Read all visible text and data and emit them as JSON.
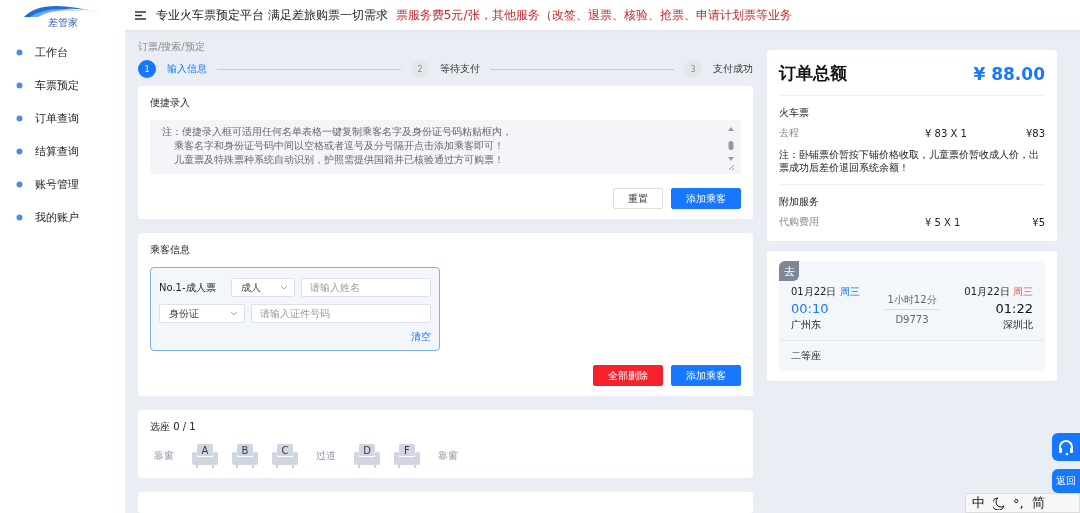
{
  "logo": {
    "text": "差管家"
  },
  "header": {
    "slogan": "专业火车票预定平台 满足差旅购票一切需求",
    "notice": "票服务费5元/张，其他服务（改签、退票、核验、抢票、申请计划票等业务"
  },
  "sidebar": {
    "items": [
      {
        "label": "工作台",
        "selected": false
      },
      {
        "label": "车票预定",
        "selected": false
      },
      {
        "label": "订单查询",
        "selected": false
      },
      {
        "label": "结算查询",
        "selected": false
      },
      {
        "label": "账号管理",
        "selected": false
      },
      {
        "label": "我的账户",
        "selected": false
      }
    ]
  },
  "breadcrumb": "订票/搜索/预定",
  "steps": [
    {
      "number": "1",
      "label": "输入信息",
      "selected": true
    },
    {
      "number": "2",
      "label": "等待支付",
      "selected": false
    },
    {
      "number": "3",
      "label": "支付成功",
      "selected": false
    }
  ],
  "quick_entry": {
    "title": "便捷录入",
    "placeholder": [
      "注：便捷录入框可适用任何名单表格一键复制乘客名字及身份证号码粘贴框内，",
      "乘客名字和身份证号码中间以空格或者逗号及分号隔开点击添加乘客即可！",
      "儿童票及特殊票种系统自动识别，护照需提供国籍并已核验通过方可购票！"
    ],
    "buttons": [
      {
        "label": "重置",
        "kind": "default"
      },
      {
        "label": "添加乘客",
        "kind": "primary"
      }
    ]
  },
  "passengers": {
    "title": "乘客信息",
    "items": [
      {
        "label": "No.1-成人票",
        "ticket_type": "成人",
        "name_placeholder": "请输入姓名",
        "id_type": "身份证",
        "id_placeholder": "请输入证件号码",
        "clear": "清空"
      }
    ],
    "buttons": [
      {
        "label": "全部删除",
        "kind": "danger"
      },
      {
        "label": "添加乘客",
        "kind": "primary"
      }
    ]
  },
  "seats": {
    "title": "选座 0 / 1",
    "items": [
      {
        "kind": "label",
        "text": "靠窗"
      },
      {
        "kind": "seat",
        "text": "A"
      },
      {
        "kind": "seat",
        "text": "B"
      },
      {
        "kind": "seat",
        "text": "C"
      },
      {
        "kind": "label",
        "text": "过道"
      },
      {
        "kind": "seat",
        "text": "D"
      },
      {
        "kind": "seat",
        "text": "F"
      },
      {
        "kind": "label",
        "text": "靠窗"
      }
    ]
  },
  "order": {
    "title": "订单总额",
    "total": "¥ 88.00",
    "sections": [
      {
        "title": "火车票",
        "rows": [
          {
            "name": "去程",
            "price": "¥ 83 X 1",
            "amount": "¥83"
          }
        ],
        "note": "注：卧铺票价暂按下铺价格收取，儿童票价暂收成人价，出票成功后差价退回系统余额！"
      },
      {
        "title": "附加服务",
        "rows": [
          {
            "name": "代购费用",
            "price": "¥ 5 X 1",
            "amount": "¥5"
          }
        ]
      }
    ]
  },
  "trip": {
    "tag": "去",
    "depart": {
      "date": "01月22日",
      "weekday": "周三",
      "time": "00:10",
      "station": "广州东"
    },
    "duration": "1小时12分",
    "train": "D9773",
    "arrive": {
      "date": "01月22日",
      "weekday": "周三",
      "time": "01:22",
      "station": "深圳北"
    },
    "seat_class": "二等座"
  },
  "float_buttons": {
    "back": "返回"
  },
  "ime_bar": {
    "items": [
      "中",
      "°,",
      "简"
    ]
  }
}
